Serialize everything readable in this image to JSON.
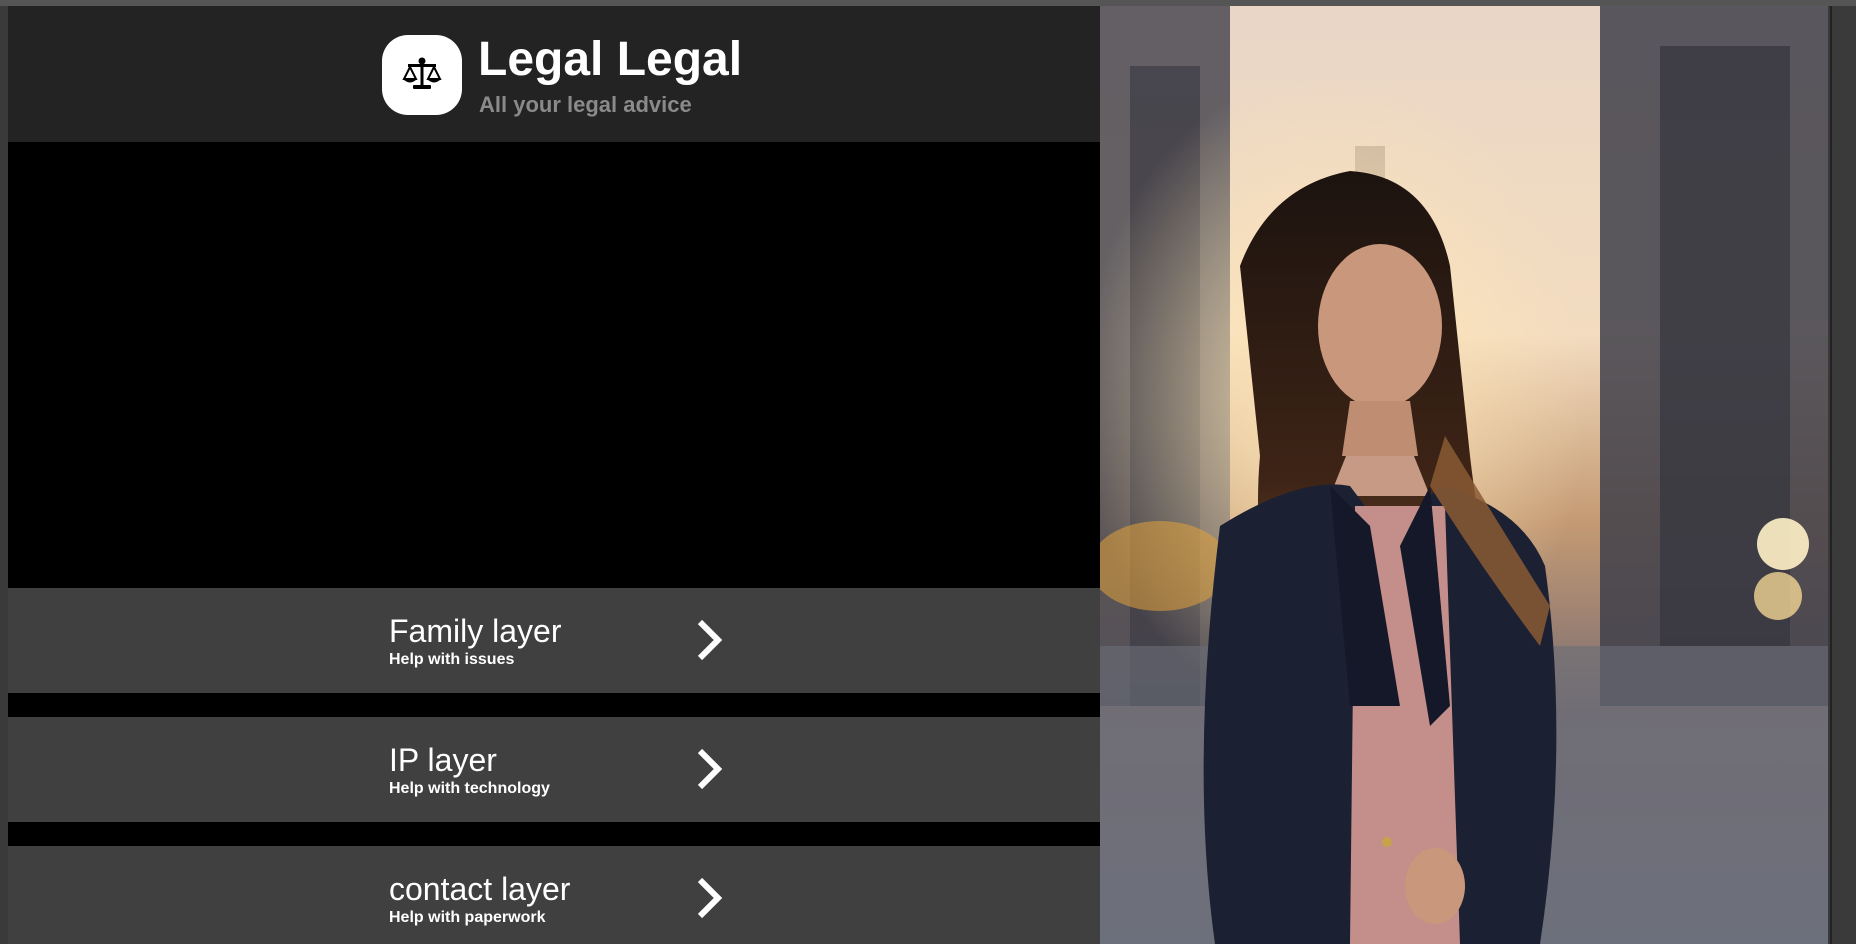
{
  "brand": {
    "title": "Legal Legal",
    "subtitle": "All your legal advice",
    "logo_icon": "scales-of-justice-icon"
  },
  "menu": {
    "items": [
      {
        "title": "Family layer",
        "subtitle": "Help with issues",
        "icon": "chevron-right-icon"
      },
      {
        "title": "IP layer",
        "subtitle": "Help with technology",
        "icon": "chevron-right-icon"
      },
      {
        "title": "contact layer",
        "subtitle": "Help with paperwork",
        "icon": "chevron-right-icon"
      }
    ]
  },
  "colors": {
    "header_bg": "#232323",
    "hero_bg": "#000000",
    "menu_item_bg": "#404040",
    "title_text": "#ffffff",
    "subtitle_text": "#8a8a8a"
  }
}
